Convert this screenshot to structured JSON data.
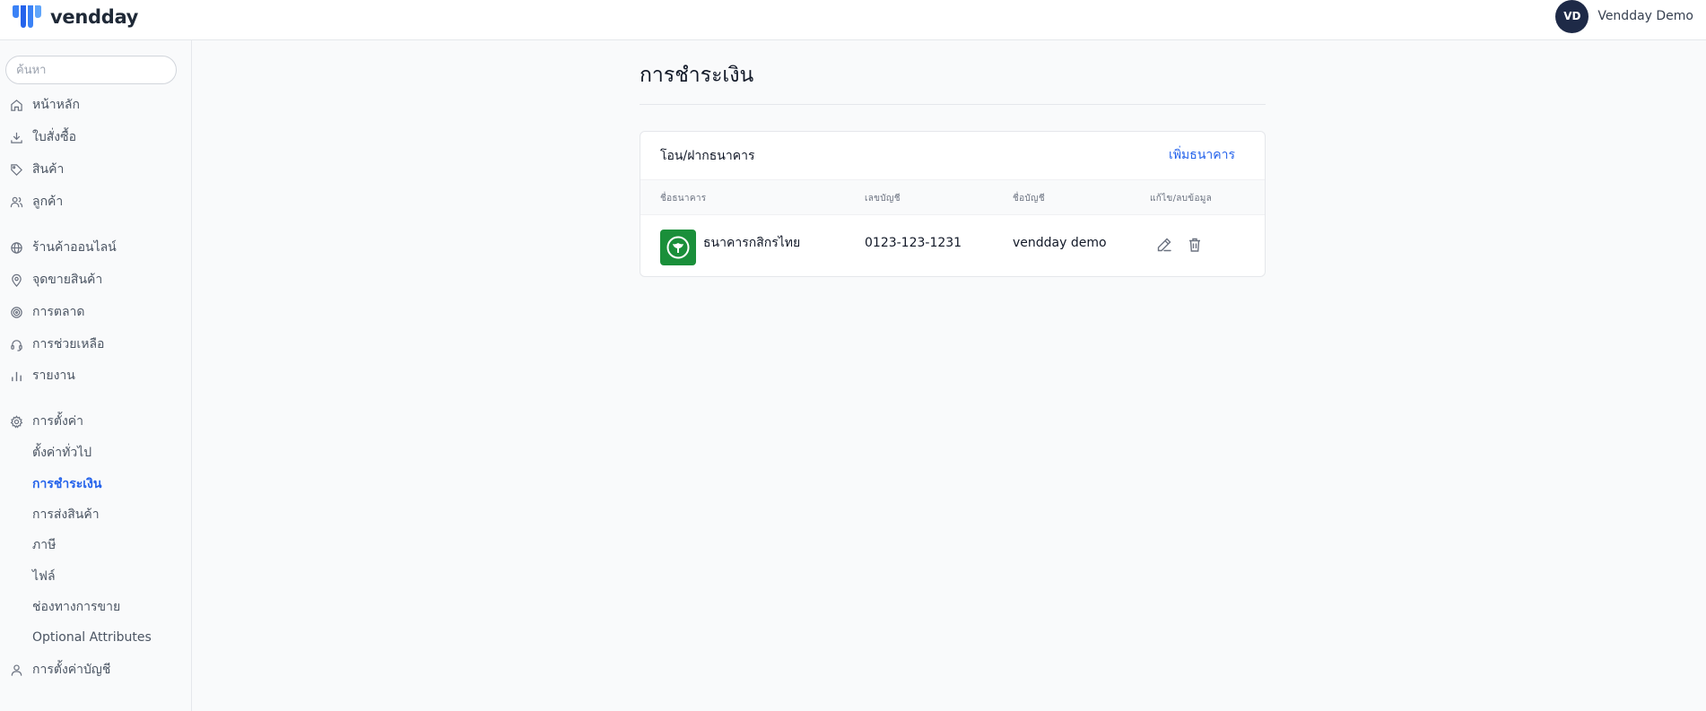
{
  "header": {
    "brand": "vendday",
    "user": {
      "initials": "VD",
      "name": "Vendday Demo"
    }
  },
  "sidebar": {
    "search_placeholder": "ค้นหา",
    "items": [
      {
        "label": "หน้าหลัก",
        "icon": "home-icon"
      },
      {
        "label": "ใบสั่งซื้อ",
        "icon": "download-icon"
      },
      {
        "label": "สินค้า",
        "icon": "tag-icon"
      },
      {
        "label": "ลูกค้า",
        "icon": "users-icon"
      },
      {
        "label": "ร้านค้าออนไลน์",
        "icon": "globe-icon"
      },
      {
        "label": "จุดขายสินค้า",
        "icon": "location-pin-icon"
      },
      {
        "label": "การตลาด",
        "icon": "target-icon"
      },
      {
        "label": "การช่วยเหลือ",
        "icon": "headset-icon"
      },
      {
        "label": "รายงาน",
        "icon": "bar-chart-icon"
      },
      {
        "label": "การตั้งค่า",
        "icon": "gear-icon"
      }
    ],
    "settings_sub": [
      {
        "label": "ตั้งค่าทั่วไป"
      },
      {
        "label": "การชำระเงิน"
      },
      {
        "label": "การส่งสินค้า"
      },
      {
        "label": "ภาษี"
      },
      {
        "label": "ไฟล์"
      },
      {
        "label": "ช่องทางการขาย"
      },
      {
        "label": "Optional Attributes"
      }
    ],
    "account_settings": {
      "label": "การตั้งค่าบัญชี",
      "icon": "user-icon"
    },
    "active_sub": "การชำระเงิน"
  },
  "main": {
    "title": "การชำระเงิน",
    "card": {
      "title": "โอน/ฝากธนาคาร",
      "add_label": "เพิ่มธนาคาร",
      "columns": [
        "ชื่อธนาคาร",
        "เลขบัญชี",
        "ชื่อบัญชี",
        "แก้ไข/ลบข้อมูล"
      ],
      "rows": [
        {
          "bank_name": "ธนาคารกสิกรไทย",
          "bank_logo": "kasikorn-bank-logo",
          "account_number": "0123-123-1231",
          "account_name": "vendday demo",
          "actions": [
            "edit-icon",
            "trash-icon"
          ]
        }
      ]
    }
  },
  "colors": {
    "accent": "#2563eb",
    "avatar_bg": "#1e2a47",
    "bank_logo_bg": "#1a8f3a",
    "brand_blue": "#3b82f6"
  }
}
